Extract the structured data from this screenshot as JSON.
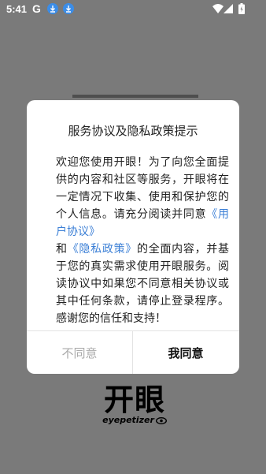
{
  "status_bar": {
    "time": "5:41",
    "g_label": "G"
  },
  "dialog": {
    "title": "服务协议及隐私政策提示",
    "body_part1": "欢迎您使用开眼！为了向您全面提供的内容和社区等服务，开眼将在一定情况下收集、使用和保护您的个人信息。请充分阅读并同意",
    "link_user_agreement": "《用户协议》",
    "body_and": "和",
    "link_privacy_policy": "《隐私政策》",
    "body_part2": "的全面内容，并基于您的真实需求使用开眼服务。阅读协议中如果您不同意相关协议或其中任何条款，请停止登录程序。感谢您的信任和支持！",
    "disagree_label": "不同意",
    "agree_label": "我同意"
  },
  "brand": {
    "name_cn": "开眼",
    "name_en": "eyepetizer"
  },
  "colors": {
    "overlay": "#7a7a7a",
    "link": "#3b7fd6",
    "download_badge": "#3b8de8"
  }
}
